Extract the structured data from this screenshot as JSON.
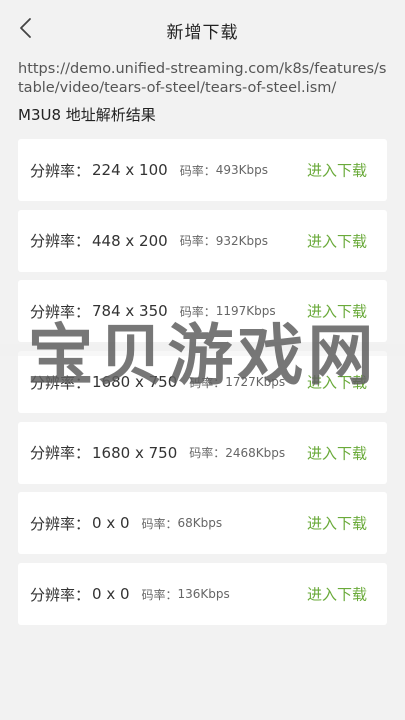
{
  "header": {
    "title": "新增下载",
    "back_icon": "chevron-left-icon"
  },
  "url": "https://demo.unified-streaming.com/k8s/features/stable/video/tears-of-steel/tears-of-steel.ism/",
  "section_title": "M3U8 地址解析结果",
  "colors": {
    "accent": "#6aaa3a",
    "background": "#f2f2f2",
    "card": "#ffffff"
  },
  "items": [
    {
      "res_label": "分辨率：",
      "resolution": "224 x 100",
      "rate_label": "码率：",
      "bitrate": "493Kbps",
      "action": "进入下载"
    },
    {
      "res_label": "分辨率：",
      "resolution": "448 x 200",
      "rate_label": "码率：",
      "bitrate": "932Kbps",
      "action": "进入下载"
    },
    {
      "res_label": "分辨率：",
      "resolution": "784 x 350",
      "rate_label": "码率：",
      "bitrate": "1197Kbps",
      "action": "进入下载"
    },
    {
      "res_label": "分辨率：",
      "resolution": "1680 x 750",
      "rate_label": "码率：",
      "bitrate": "1727Kbps",
      "action": "进入下载"
    },
    {
      "res_label": "分辨率：",
      "resolution": "1680 x 750",
      "rate_label": "码率：",
      "bitrate": "2468Kbps",
      "action": "进入下载"
    },
    {
      "res_label": "分辨率：",
      "resolution": "0 x 0",
      "rate_label": "码率：",
      "bitrate": "68Kbps",
      "action": "进入下载"
    },
    {
      "res_label": "分辨率：",
      "resolution": "0 x 0",
      "rate_label": "码率：",
      "bitrate": "136Kbps",
      "action": "进入下载"
    }
  ],
  "watermark": "宝贝游戏网"
}
